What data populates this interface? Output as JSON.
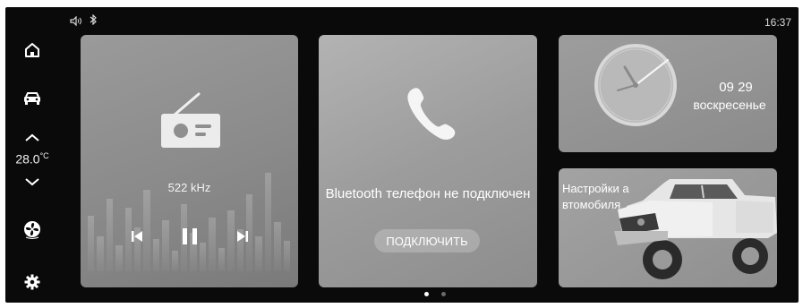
{
  "status_bar": {
    "volume_icon": "speaker-icon",
    "bluetooth_icon": "bluetooth-icon",
    "time": "16:37"
  },
  "sidebar": {
    "items": [
      {
        "name": "home",
        "icon": "home-icon"
      },
      {
        "name": "vehicle",
        "icon": "car-icon"
      },
      {
        "name": "temp-up",
        "icon": "chevron-up-icon"
      },
      {
        "name": "temp-down",
        "icon": "chevron-down-icon"
      },
      {
        "name": "fan",
        "icon": "fan-icon"
      },
      {
        "name": "settings",
        "icon": "gear-icon"
      }
    ],
    "temperature": "28.0",
    "temperature_unit": "°C"
  },
  "radio": {
    "frequency": "522 kHz",
    "icons": [
      "radio-icon",
      "previous-icon",
      "pause-icon",
      "next-icon"
    ]
  },
  "phone": {
    "status": "Bluetooth телефон не подключен",
    "connect_label": "ПОДКЛЮЧИТЬ"
  },
  "clock_widget": {
    "time": "09 29",
    "day": "воскресенье"
  },
  "vehicle_settings": {
    "title": "Настройки автомобиля"
  },
  "pager": {
    "count": 2,
    "active_index": 0
  }
}
